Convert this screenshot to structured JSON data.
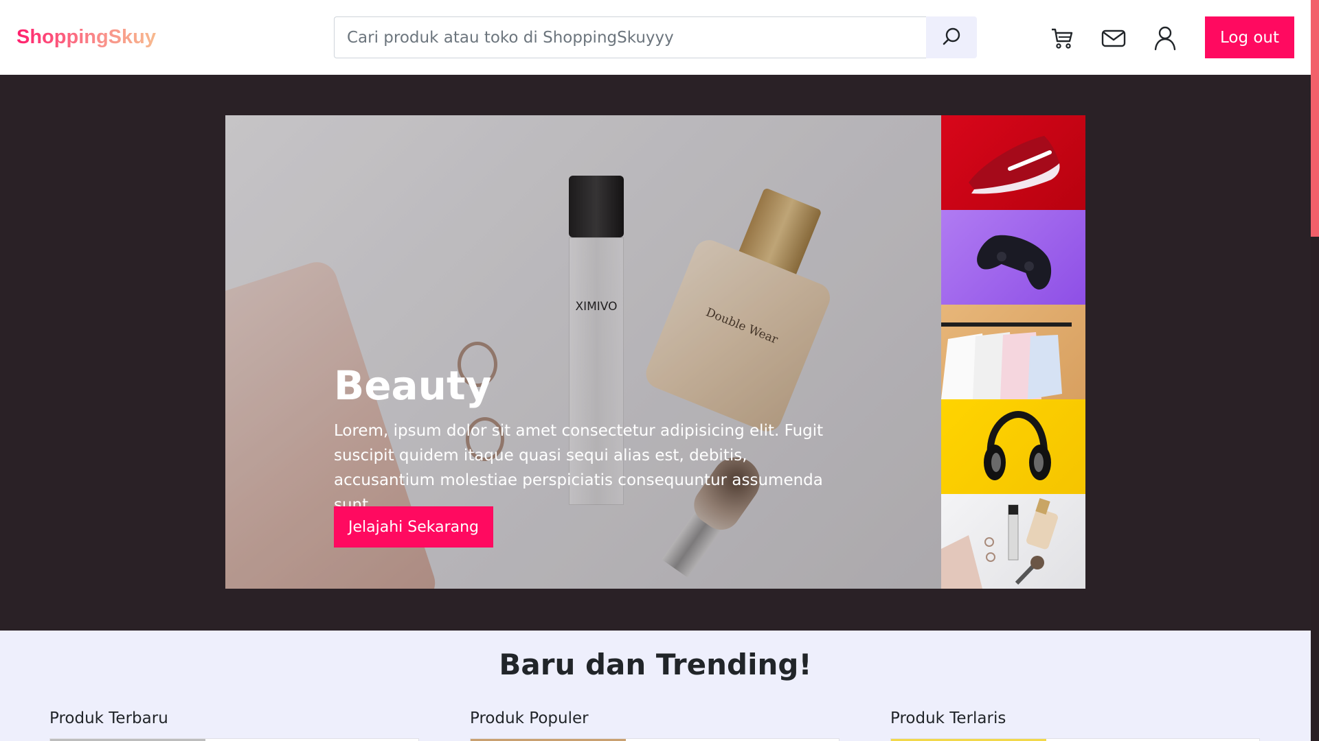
{
  "header": {
    "brand": "ShoppingSkuy",
    "search_placeholder": "Cari produk atau toko di ShoppingSkuyyy",
    "search_value": "",
    "icons": [
      "search-icon",
      "cart-icon",
      "mail-icon",
      "user-icon"
    ],
    "logout_label": "Log out"
  },
  "hero": {
    "slide_title": "Beauty",
    "slide_text": "Lorem, ipsum dolor sit amet consectetur adipisicing elit. Fugit suscipit quidem itaque quasi sequi alias est, debitis, accusantium molestiae perspiciatis consequuntur assumenda sunt.",
    "cta_label": "Jelajahi Sekarang",
    "thumbnails": [
      {
        "name": "sneaker",
        "color": "#D8061A"
      },
      {
        "name": "game-controller",
        "color": "#9B5CF0"
      },
      {
        "name": "clothing-rack",
        "color": "#E0AC6C"
      },
      {
        "name": "headphones",
        "color": "#FFD000"
      },
      {
        "name": "beauty-products",
        "color": "#EDEDEF"
      }
    ],
    "product_label": "XIMIVO",
    "foundation_label": "Double Wear"
  },
  "trending": {
    "title": "Baru dan Trending!",
    "columns": [
      {
        "label": "Produk Terbaru",
        "accent": "#BDBDBD"
      },
      {
        "label": "Produk Populer",
        "accent": "#C9A070"
      },
      {
        "label": "Produk Terlaris",
        "accent": "#F2D84A"
      }
    ]
  },
  "colors": {
    "accent": "#FF0A60",
    "hero_bg": "#2A2126",
    "page_bg": "#EEEFFC"
  }
}
